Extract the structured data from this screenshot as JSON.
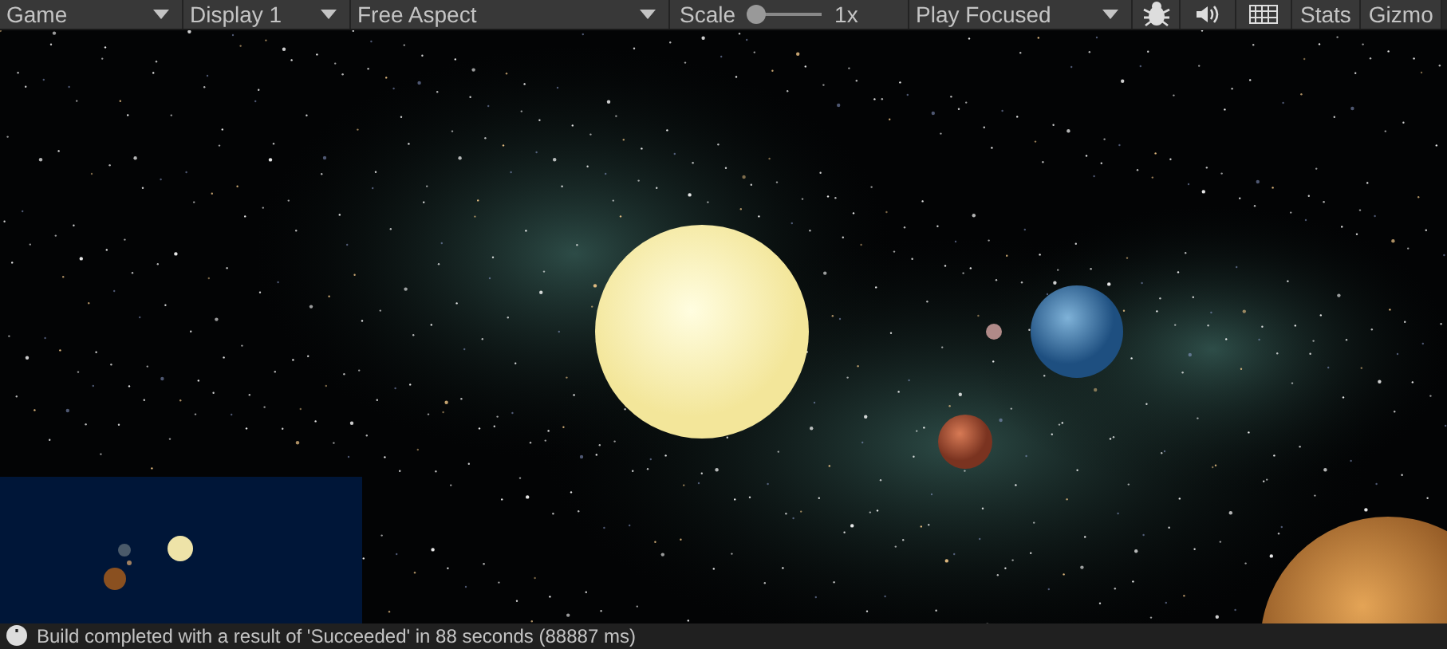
{
  "toolbar": {
    "view": {
      "label": "Game"
    },
    "display": {
      "label": "Display 1"
    },
    "aspect": {
      "label": "Free Aspect"
    },
    "scale": {
      "label": "Scale",
      "level": 0.1,
      "reading": "1x"
    },
    "play_mode": {
      "label": "Play Focused"
    },
    "stats": {
      "label": "Stats",
      "selected": false
    },
    "gizmos": {
      "label": "Gizmo",
      "selected": false
    }
  },
  "status_bar": {
    "message": "Build completed with a result of 'Succeeded' in 88 seconds (88887 ms)"
  }
}
